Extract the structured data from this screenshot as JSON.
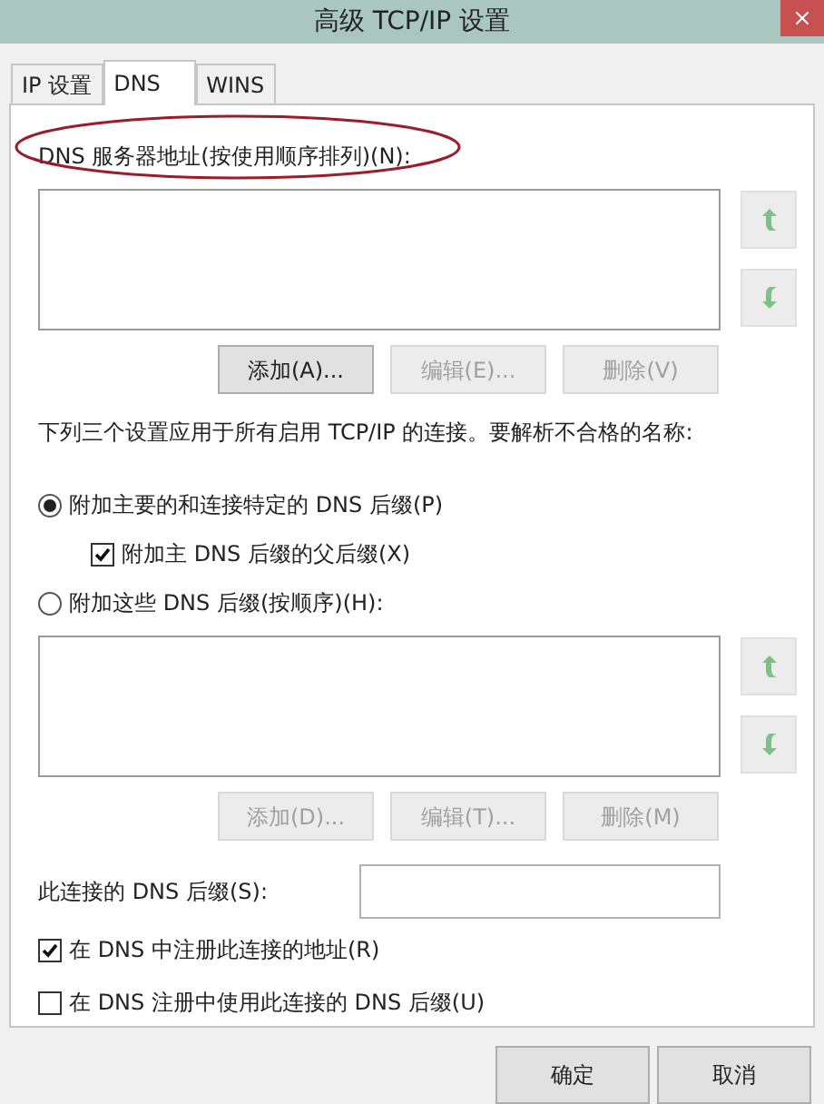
{
  "window": {
    "title": "高级 TCP/IP 设置"
  },
  "tabs": [
    {
      "label": "IP 设置",
      "selected": false
    },
    {
      "label": "DNS",
      "selected": true
    },
    {
      "label": "WINS",
      "selected": false
    }
  ],
  "dns_servers": {
    "label": "DNS 服务器地址(按使用顺序排列)(N):",
    "buttons": [
      {
        "label": "添加(A)...",
        "disabled": false
      },
      {
        "label": "编辑(E)...",
        "disabled": true
      },
      {
        "label": "删除(V)",
        "disabled": true
      }
    ]
  },
  "description": "下列三个设置应用于所有启用 TCP/IP 的连接。要解析不合格的名称:",
  "options": [
    {
      "label": "附加主要的和连接特定的 DNS 后缀(P)",
      "selected": true,
      "children": [
        {
          "label": "附加主 DNS 后缀的父后缀(X)",
          "checked": true
        }
      ]
    },
    {
      "label": "附加这些 DNS 后缀(按顺序)(H):",
      "selected": false
    }
  ],
  "suffix_list": {
    "buttons": [
      {
        "label": "添加(D)...",
        "disabled": true
      },
      {
        "label": "编辑(T)...",
        "disabled": true
      },
      {
        "label": "删除(M)",
        "disabled": true
      }
    ]
  },
  "connection_suffix": {
    "label": "此连接的 DNS 后缀(S):"
  },
  "checks": [
    {
      "label": "在 DNS 中注册此连接的地址(R)",
      "checked": true
    },
    {
      "label": "在 DNS 注册中使用此连接的 DNS 后缀(U)",
      "checked": false
    }
  ],
  "footer_buttons": [
    {
      "label": "确定"
    },
    {
      "label": "取消"
    }
  ]
}
